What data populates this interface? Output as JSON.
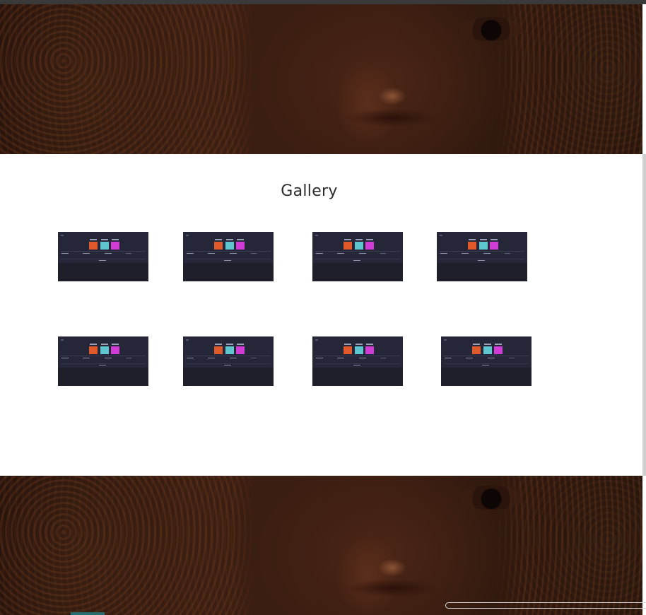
{
  "gallery": {
    "title": "Gallery",
    "items": [
      {
        "alt": "dashboard-screenshot-1"
      },
      {
        "alt": "dashboard-screenshot-2"
      },
      {
        "alt": "dashboard-screenshot-3"
      },
      {
        "alt": "dashboard-screenshot-4"
      },
      {
        "alt": "dashboard-screenshot-5"
      },
      {
        "alt": "dashboard-screenshot-6"
      },
      {
        "alt": "dashboard-screenshot-7"
      },
      {
        "alt": "dashboard-screenshot-8"
      }
    ]
  },
  "colors": {
    "tile_orange": "#e0592a",
    "tile_cyan": "#5fc6cf",
    "tile_magenta": "#d13bd6",
    "thumb_bg": "#252637"
  }
}
